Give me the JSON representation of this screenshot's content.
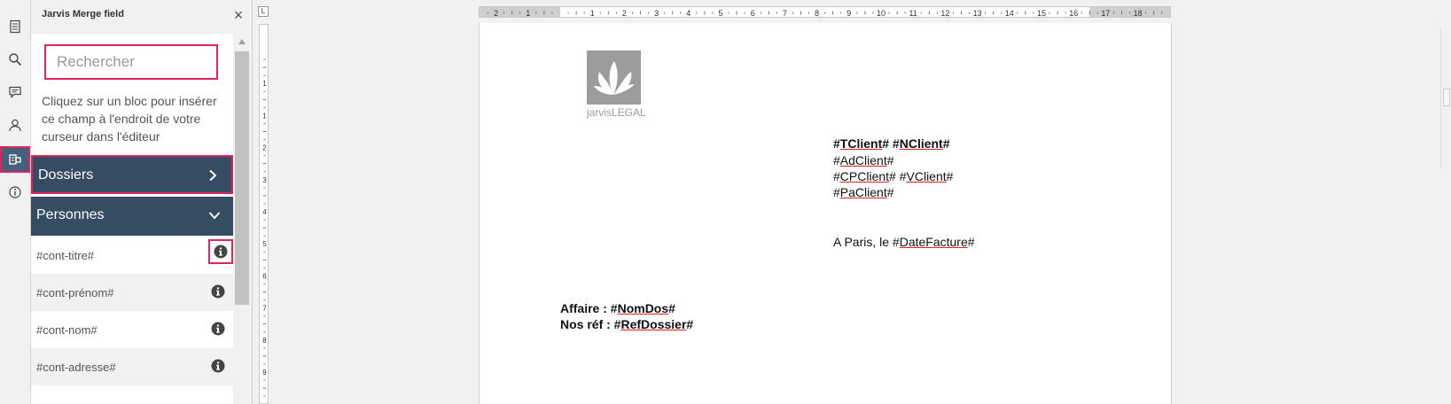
{
  "panel": {
    "title": "Jarvis Merge field",
    "search_placeholder": "Rechercher",
    "help_text": "Cliquez sur un bloc pour insérer ce champ à l'endroit de votre curseur dans l'éditeur",
    "sections": [
      {
        "label": "Dossiers",
        "state": "collapsed"
      },
      {
        "label": "Personnes",
        "state": "expanded"
      }
    ],
    "fields": [
      "#cont-titre#",
      "#cont-prénom#",
      "#cont-nom#",
      "#cont-adresse#"
    ]
  },
  "ruler": {
    "h_labels": [
      "2",
      "1",
      "1",
      "2",
      "3",
      "4",
      "5",
      "6",
      "7",
      "8",
      "9",
      "10",
      "11",
      "12",
      "13",
      "14",
      "15",
      "16",
      "17",
      "18"
    ],
    "v_labels": [
      "1",
      "1",
      "2",
      "3",
      "4",
      "5",
      "6",
      "7",
      "8",
      "9"
    ]
  },
  "document": {
    "logo_text": "jarvisLEGAL",
    "addr": [
      [
        "#",
        "TClient",
        "# #",
        "NClient",
        "#"
      ],
      [
        "#",
        "AdClient",
        "#"
      ],
      [
        "#",
        "CPClient",
        "# #",
        "VClient",
        "#"
      ],
      [
        "#",
        "PaClient",
        "#"
      ]
    ],
    "date_prefix": "A Paris, le #",
    "date_field": "DateFacture",
    "date_suffix": "#",
    "affaire_prefix": "Affaire : #",
    "affaire_field": "NomDos",
    "affaire_suffix": "#",
    "ref_prefix": "Nos réf : #",
    "ref_field": "RefDossier",
    "ref_suffix": "#"
  },
  "colors": {
    "accent": "#e0245e",
    "section_bg": "#354c63"
  }
}
